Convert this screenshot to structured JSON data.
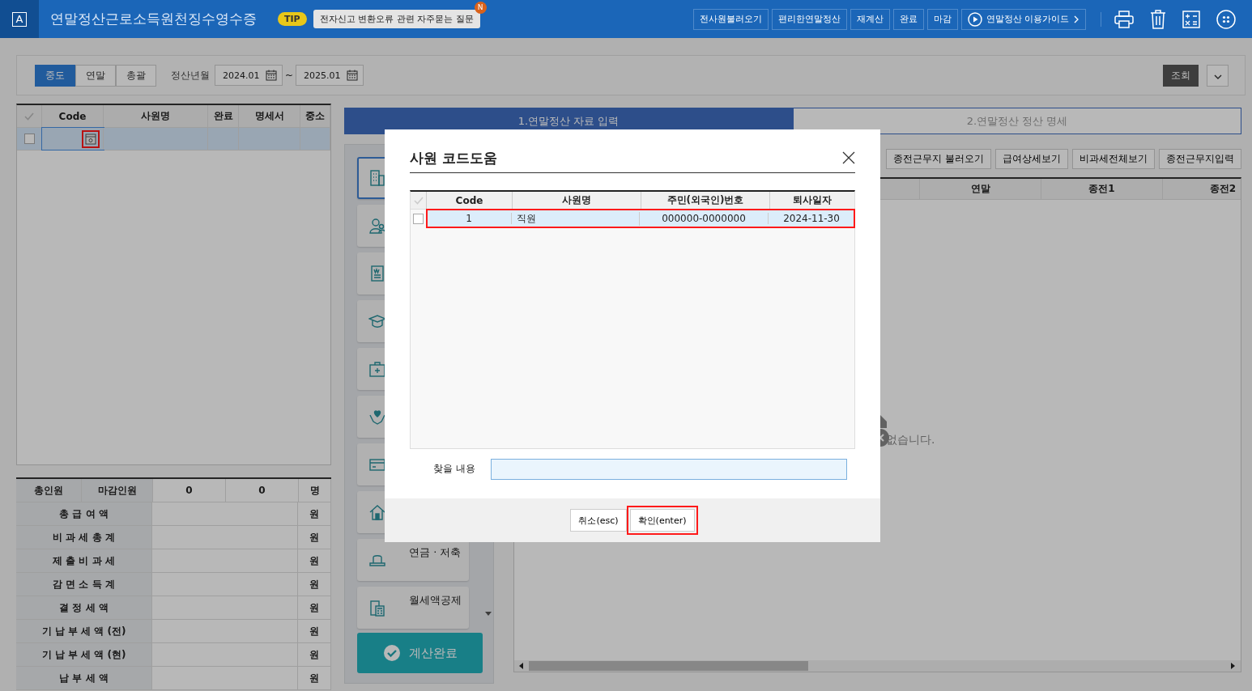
{
  "app": {
    "logo": "A",
    "title": "연말정산근로소득원천징수영수증",
    "tip": {
      "badge": "TIP",
      "text": "전자신고 변환오류 관련 자주묻는 질문",
      "new_badge": "N"
    },
    "toolbar": [
      "전사원불러오기",
      "편리한연말정산",
      "재계산",
      "완료",
      "마감"
    ],
    "guide": "연말정산 이용가이드"
  },
  "filter": {
    "modes": [
      {
        "label": "중도",
        "selected": true
      },
      {
        "label": "연말",
        "selected": false
      },
      {
        "label": "총괄",
        "selected": false
      }
    ],
    "period_label": "정산년월",
    "from": "2024.01",
    "separator": "~",
    "to": "2025.01",
    "search_button": "조회"
  },
  "employee_grid": {
    "columns": [
      "Code",
      "사원명",
      "완료",
      "명세서",
      "중소"
    ],
    "rows": [
      {
        "checked": false,
        "selected": true,
        "lookup_highlighted": true
      }
    ]
  },
  "summary": {
    "labels": [
      "총인원",
      "마감인원"
    ],
    "values": [
      "0",
      "0"
    ],
    "unit": "명",
    "rows": [
      {
        "label": "총 급 여 액",
        "unit": "원"
      },
      {
        "label": "비 과 세 총 계",
        "unit": "원"
      },
      {
        "label": "제 출 비 과 세",
        "unit": "원"
      },
      {
        "label": "감 면 소 득 계",
        "unit": "원"
      },
      {
        "label": "결 정 세 액",
        "unit": "원"
      },
      {
        "label": "기 납 부 세 액 (전)",
        "unit": "원"
      },
      {
        "label": "기 납 부 세 액 (현)",
        "unit": "원"
      },
      {
        "label": "납 부 세 액",
        "unit": "원"
      }
    ]
  },
  "tabs": [
    {
      "label": "1.연말정산 자료 입력",
      "selected": true
    },
    {
      "label": "2.연말정산 정산 명세",
      "selected": false
    }
  ],
  "side_menu": [
    {
      "kind": "building",
      "selected": true
    },
    {
      "kind": "people",
      "selected": false
    },
    {
      "kind": "document",
      "selected": false
    },
    {
      "kind": "graduation",
      "selected": false
    },
    {
      "kind": "medical",
      "selected": false
    },
    {
      "kind": "care",
      "selected": false
    },
    {
      "kind": "card",
      "selected": false
    },
    {
      "kind": "house",
      "selected": false
    },
    {
      "kind": "hat",
      "selected": false,
      "label": "연금 · 저축"
    },
    {
      "kind": "calculator",
      "selected": false,
      "label": "월세액공제"
    }
  ],
  "calc_button": "계산완료",
  "detail": {
    "buttons": [
      "종전근무지 불러오기",
      "급여상세보기",
      "비과세전체보기",
      "종전근무지입력"
    ],
    "columns": [
      "연말",
      "종전1",
      "종전2"
    ],
    "empty_text": "없습니다."
  },
  "dialog": {
    "title": "사원 코드도움",
    "columns": [
      "Code",
      "사원명",
      "주민(외국인)번호",
      "퇴사일자"
    ],
    "rows": [
      {
        "checked": false,
        "selected": true,
        "highlighted": true,
        "cells": [
          "1",
          "직원",
          "000000-0000000",
          "2024-11-30"
        ]
      }
    ],
    "search_label": "찾을 내용",
    "buttons": [
      {
        "label": "취소(esc)",
        "highlighted": false
      },
      {
        "label": "확인(enter)",
        "highlighted": true
      }
    ]
  }
}
